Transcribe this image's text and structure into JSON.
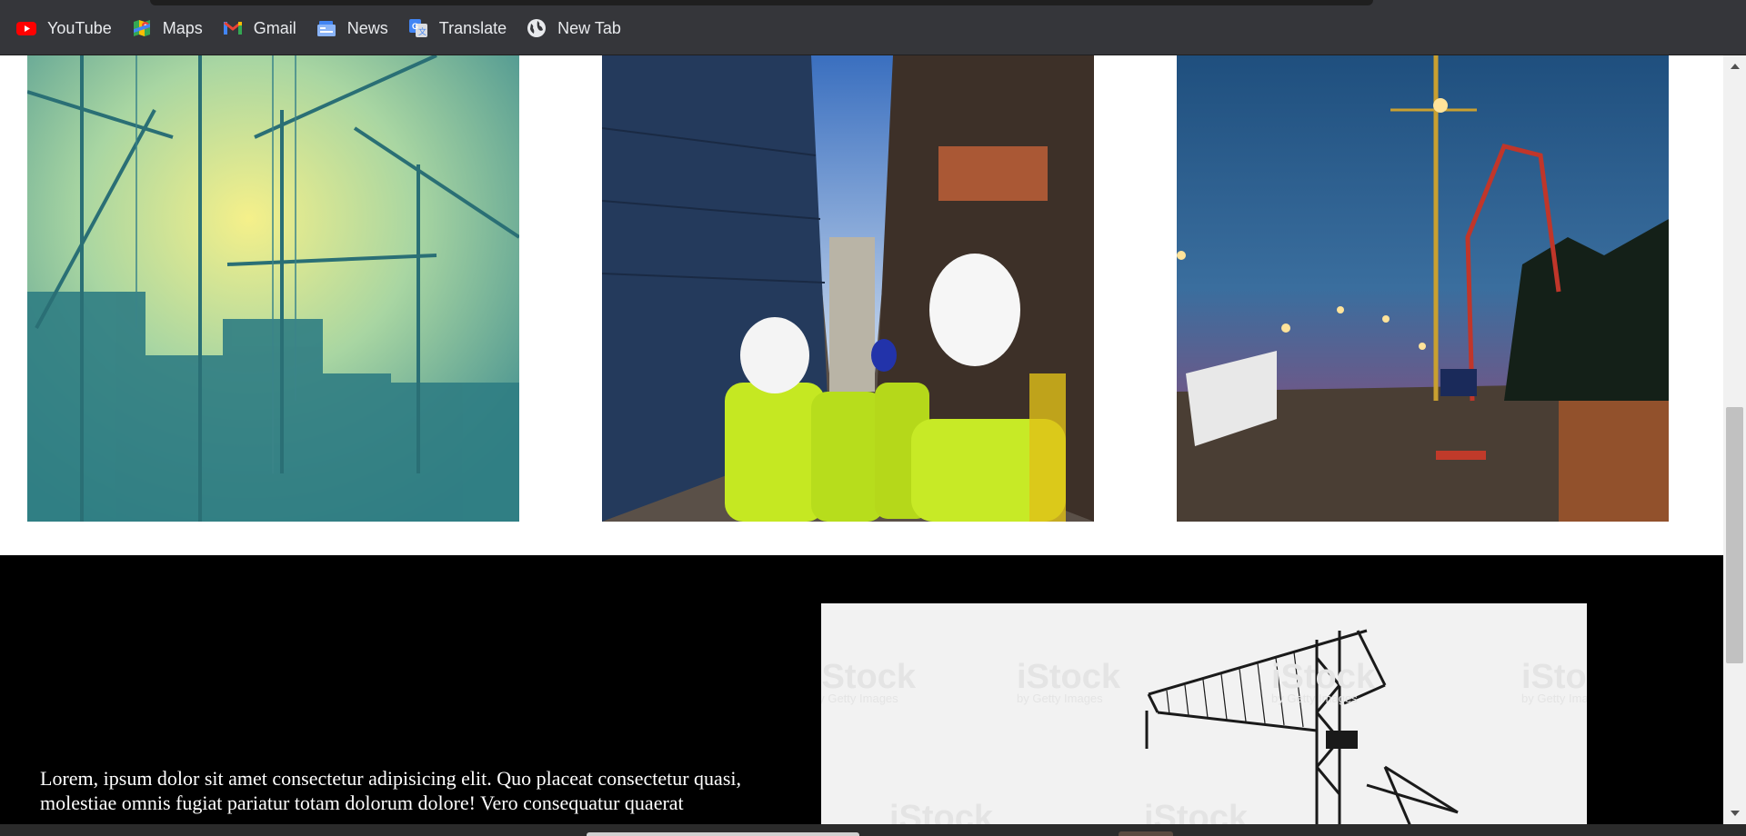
{
  "bookmarks": [
    {
      "label": "YouTube",
      "icon": "youtube-icon"
    },
    {
      "label": "Maps",
      "icon": "maps-icon"
    },
    {
      "label": "Gmail",
      "icon": "gmail-icon"
    },
    {
      "label": "News",
      "icon": "news-icon"
    },
    {
      "label": "Translate",
      "icon": "translate-icon"
    },
    {
      "label": "New Tab",
      "icon": "globe-icon"
    }
  ],
  "gallery": {
    "images": [
      {
        "subject": "crane silhouettes at sunrise"
      },
      {
        "subject": "workers in hard hats at construction site"
      },
      {
        "subject": "construction site at dusk"
      }
    ]
  },
  "about": {
    "text": "Lorem, ipsum dolor sit amet consectetur adipisicing elit. Quo placeat consectetur quasi, molestiae omnis fugiat pariatur totam dolorum dolore! Vero consequatur quaerat"
  },
  "stock_image": {
    "subject": "tower crane black and white",
    "watermark": "iStock",
    "watermark_sub": "by Getty Images"
  },
  "colors": {
    "toolbar": "#35363a",
    "dark_section": "#000000",
    "scroll_thumb": "#c1c1c1"
  }
}
